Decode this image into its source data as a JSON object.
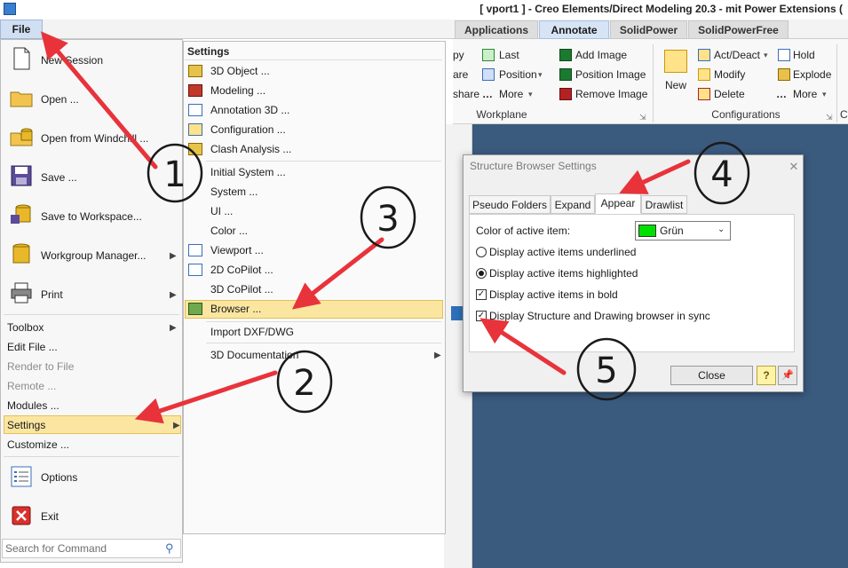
{
  "window": {
    "title": "[ vport1 ] - Creo Elements/Direct Modeling 20.3 - mit Power Extensions ("
  },
  "ribbon_tabs": [
    {
      "label": "Applications"
    },
    {
      "label": "Annotate"
    },
    {
      "label": "SolidPower"
    },
    {
      "label": "SolidPowerFree"
    }
  ],
  "ribbon": {
    "clipped": [
      "py",
      "are",
      "share"
    ],
    "last": "Last",
    "position": "Position",
    "more": "More",
    "add_image": "Add Image",
    "position_image": "Position Image",
    "remove_image": "Remove Image",
    "new": "New",
    "act_deact": "Act/Deact",
    "modify": "Modify",
    "delete": "Delete",
    "hold": "Hold",
    "explode": "Explode",
    "group_workplane": "Workplane",
    "group_configurations": "Configurations",
    "group_clip": "C"
  },
  "file_button": "File",
  "file_menu": {
    "new_session": "New Session",
    "open": "Open ...",
    "open_windchill": "Open from Windchill ...",
    "save": "Save ...",
    "save_workspace": "Save to Workspace...",
    "workgroup": "Workgroup Manager...",
    "print": "Print",
    "toolbox": "Toolbox",
    "edit_file": "Edit File ...",
    "render_file": "Render to File",
    "remote": "Remote ...",
    "modules": "Modules ...",
    "settings": "Settings",
    "customize": "Customize ...",
    "options": "Options",
    "exit": "Exit",
    "search_placeholder": "Search for Command"
  },
  "settings_menu": {
    "header": "Settings",
    "items": [
      "3D Object ...",
      "Modeling ...",
      "Annotation 3D ...",
      "Configuration ...",
      "Clash Analysis ...",
      "Initial System ...",
      "System ...",
      "UI ...",
      "Color ...",
      "Viewport ...",
      "2D CoPilot ...",
      "3D CoPilot ...",
      "Browser ...",
      "Import DXF/DWG",
      "3D Documentation"
    ]
  },
  "dialog": {
    "title": "Structure Browser Settings",
    "tabs": [
      "Pseudo Folders",
      "Expand",
      "Appear",
      "Drawlist"
    ],
    "active_tab": "Appear",
    "color_label": "Color of active item:",
    "color_value": "Grün",
    "color_hex": "#00e000",
    "opt_underlined": "Display active items underlined",
    "opt_highlighted": "Display active items highlighted",
    "opt_bold": "Display active items in bold",
    "opt_sync": "Display Structure and Drawing browser in sync",
    "close": "Close",
    "help": "?"
  },
  "annotations": {
    "labels": [
      "1",
      "2",
      "3",
      "4",
      "5"
    ],
    "arrow_color": "#e8333b"
  }
}
